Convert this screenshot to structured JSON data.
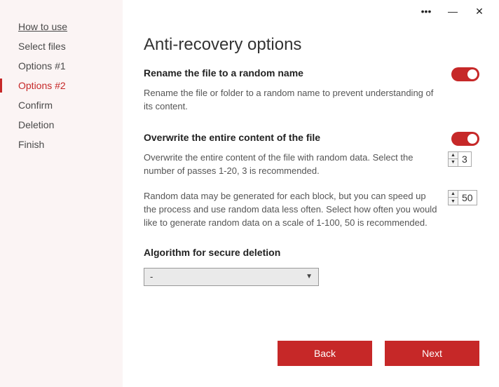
{
  "sidebar": {
    "items": [
      {
        "label": "How to use"
      },
      {
        "label": "Select files"
      },
      {
        "label": "Options #1"
      },
      {
        "label": "Options #2"
      },
      {
        "label": "Confirm"
      },
      {
        "label": "Deletion"
      },
      {
        "label": "Finish"
      }
    ],
    "activeIndex": 3
  },
  "page": {
    "title": "Anti-recovery options"
  },
  "rename": {
    "title": "Rename the file to a random name",
    "desc": "Rename the file or folder to a random name to prevent understanding of its content.",
    "enabled": true
  },
  "overwrite": {
    "title": "Overwrite the entire content of the file",
    "enabled": true,
    "passes": {
      "desc": "Overwrite the entire content of the file with random data. Select the number of passes 1-20, 3 is recommended.",
      "value": "3"
    },
    "randomness": {
      "desc": "Random data may be generated for each block, but you can speed up the process and use random data less often. Select how often you would like to generate random data on a scale of 1-100, 50 is recommended.",
      "value": "50"
    }
  },
  "algorithm": {
    "title": "Algorithm for secure deletion",
    "selected": "-"
  },
  "footer": {
    "back": "Back",
    "next": "Next"
  },
  "window": {
    "more": "•••",
    "minimize": "—",
    "close": "✕"
  }
}
